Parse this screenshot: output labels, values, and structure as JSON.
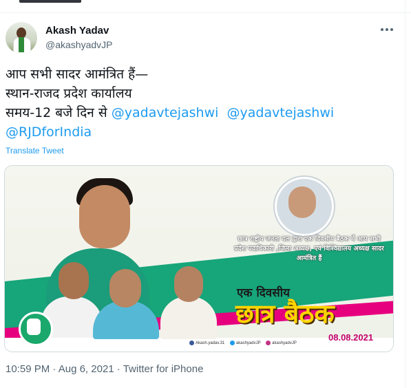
{
  "user": {
    "display_name": "Akash Yadav",
    "handle": "@akashyadvJP"
  },
  "tweet": {
    "lines": [
      {
        "text": "आप सभी सादर आमंत्रित हैं—"
      },
      {
        "text": "स्थान-राजद प्रदेश कार्यालय"
      },
      {
        "text": "समय-12 बजे दिन से ",
        "mentions": [
          "@yadavtejashwi",
          "@yadavtejashwi"
        ]
      },
      {
        "mentions": [
          "@RJDforIndia"
        ]
      }
    ],
    "translate_label": "Translate Tweet"
  },
  "media": {
    "banner_text": "छात्र राष्ट्रीय जनता दल द्वारा एक दिवसीय बैठक में आप सभी प्रदेश पदाधिकारी ,जिला अध्यक्ष, एवं विश्विद्यालय अध्यक्ष सादर आमंत्रित हैं",
    "headline_small": "एक दिवसीय",
    "headline_large": "छात्र बैठक",
    "date": "08.08.2021",
    "socials": [
      "Akash.yadav.31",
      "akashyadvJP",
      "akashyadvJP"
    ],
    "colors": {
      "green": "#17a57a",
      "pink": "#e6007e",
      "yellow": "#ffd400"
    }
  },
  "meta": {
    "time": "10:59 PM",
    "separator": " · ",
    "date": "Aug 6, 2021",
    "source": "Twitter for iPhone"
  },
  "icons": {
    "more": "more-horizontal-icon"
  },
  "colors": {
    "accent": "#1d9bf0",
    "muted": "#536471",
    "text": "#0f1419"
  }
}
